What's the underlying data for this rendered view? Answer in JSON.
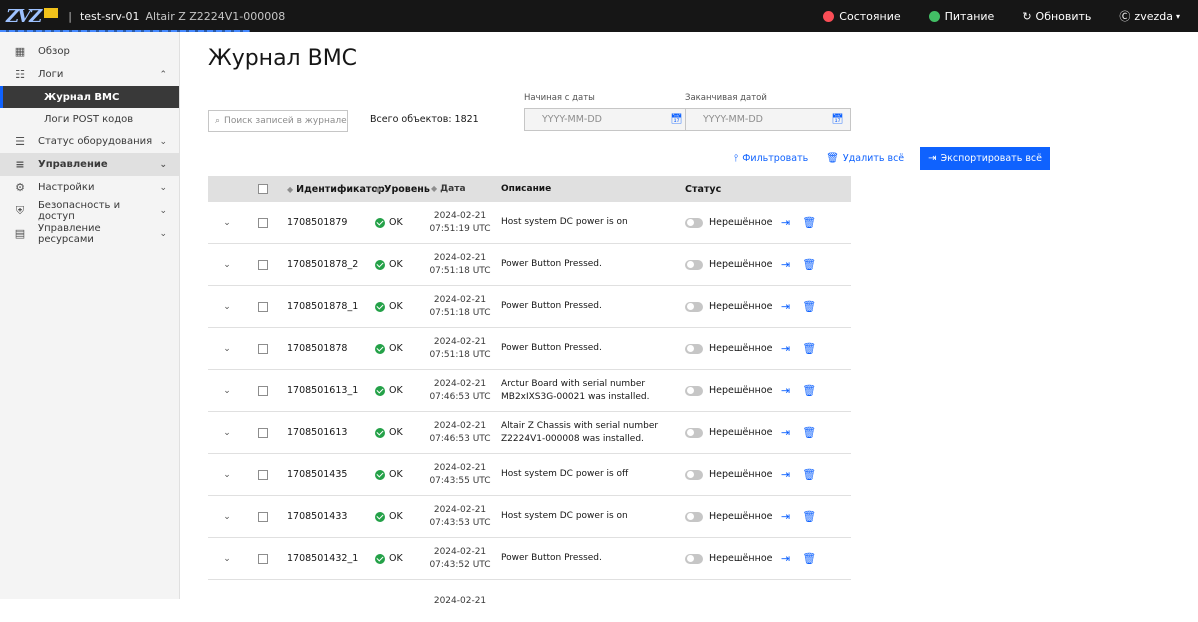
{
  "topbar": {
    "logo_text": "ZVZ",
    "host": "test-srv-01",
    "model": "Altair Z  Z2224V1-000008",
    "status_label": "Состояние",
    "power_label": "Питание",
    "refresh_label": "Обновить",
    "user_label": "zvezda",
    "colors": {
      "background": "#161616",
      "status": "#fa4d56",
      "power": "#42be65"
    }
  },
  "sidebar": {
    "items": [
      {
        "label": "Обзор",
        "icon": "dashboard-icon"
      },
      {
        "label": "Логи",
        "icon": "logs-icon",
        "expanded": true,
        "children": [
          {
            "label": "Журнал BMC",
            "active": true
          },
          {
            "label": "Логи POST кодов"
          }
        ]
      },
      {
        "label": "Статус оборудования",
        "icon": "hardware-icon"
      },
      {
        "label": "Управление",
        "icon": "control-icon",
        "selected": true
      },
      {
        "label": "Настройки",
        "icon": "settings-icon"
      },
      {
        "label": "Безопасность и доступ",
        "icon": "security-icon"
      },
      {
        "label": "Управление ресурсами",
        "icon": "resources-icon"
      }
    ]
  },
  "main": {
    "title": "Журнал BMC",
    "search_placeholder": "Поиск записей в журнале",
    "total_label": "Всего объектов: 1821",
    "start_date_label": "Начиная с даты",
    "end_date_label": "Заканчивая датой",
    "date_placeholder": "YYYY-MM-DD",
    "filter_label": "Фильтровать",
    "delete_all_label": "Удалить всё",
    "export_all_label": "Экспортировать всё",
    "accent": "#0f62fe"
  },
  "table": {
    "columns": [
      "Идентификатор",
      "Уровень",
      "Дата",
      "Описание",
      "Статус"
    ],
    "rows": [
      {
        "id": "1708501879",
        "level": "OK",
        "date": "2024-02-21",
        "time": "07:51:19 UTC",
        "desc1": "Host system DC power is on",
        "desc2": "",
        "status": "Нерешённое"
      },
      {
        "id": "1708501878_2",
        "level": "OK",
        "date": "2024-02-21",
        "time": "07:51:18 UTC",
        "desc1": "Power Button Pressed.",
        "desc2": "",
        "status": "Нерешённое"
      },
      {
        "id": "1708501878_1",
        "level": "OK",
        "date": "2024-02-21",
        "time": "07:51:18 UTC",
        "desc1": "Power Button Pressed.",
        "desc2": "",
        "status": "Нерешённое"
      },
      {
        "id": "1708501878",
        "level": "OK",
        "date": "2024-02-21",
        "time": "07:51:18 UTC",
        "desc1": "Power Button Pressed.",
        "desc2": "",
        "status": "Нерешённое"
      },
      {
        "id": "1708501613_1",
        "level": "OK",
        "date": "2024-02-21",
        "time": "07:46:53 UTC",
        "desc1": "Arctur Board with serial number",
        "desc2": "MB2xIXS3G-00021 was installed.",
        "status": "Нерешённое"
      },
      {
        "id": "1708501613",
        "level": "OK",
        "date": "2024-02-21",
        "time": "07:46:53 UTC",
        "desc1": "Altair Z Chassis with serial number",
        "desc2": "Z2224V1-000008 was installed.",
        "status": "Нерешённое"
      },
      {
        "id": "1708501435",
        "level": "OK",
        "date": "2024-02-21",
        "time": "07:43:55 UTC",
        "desc1": "Host system DC power is off",
        "desc2": "",
        "status": "Нерешённое"
      },
      {
        "id": "1708501433",
        "level": "OK",
        "date": "2024-02-21",
        "time": "07:43:53 UTC",
        "desc1": "Host system DC power is on",
        "desc2": "",
        "status": "Нерешённое"
      },
      {
        "id": "1708501432_1",
        "level": "OK",
        "date": "2024-02-21",
        "time": "07:43:52 UTC",
        "desc1": "Power Button Pressed.",
        "desc2": "",
        "status": "Нерешённое"
      },
      {
        "id": "",
        "level": "",
        "date": "2024-02-21",
        "time": "",
        "desc1": "",
        "desc2": "",
        "status": ""
      }
    ]
  }
}
